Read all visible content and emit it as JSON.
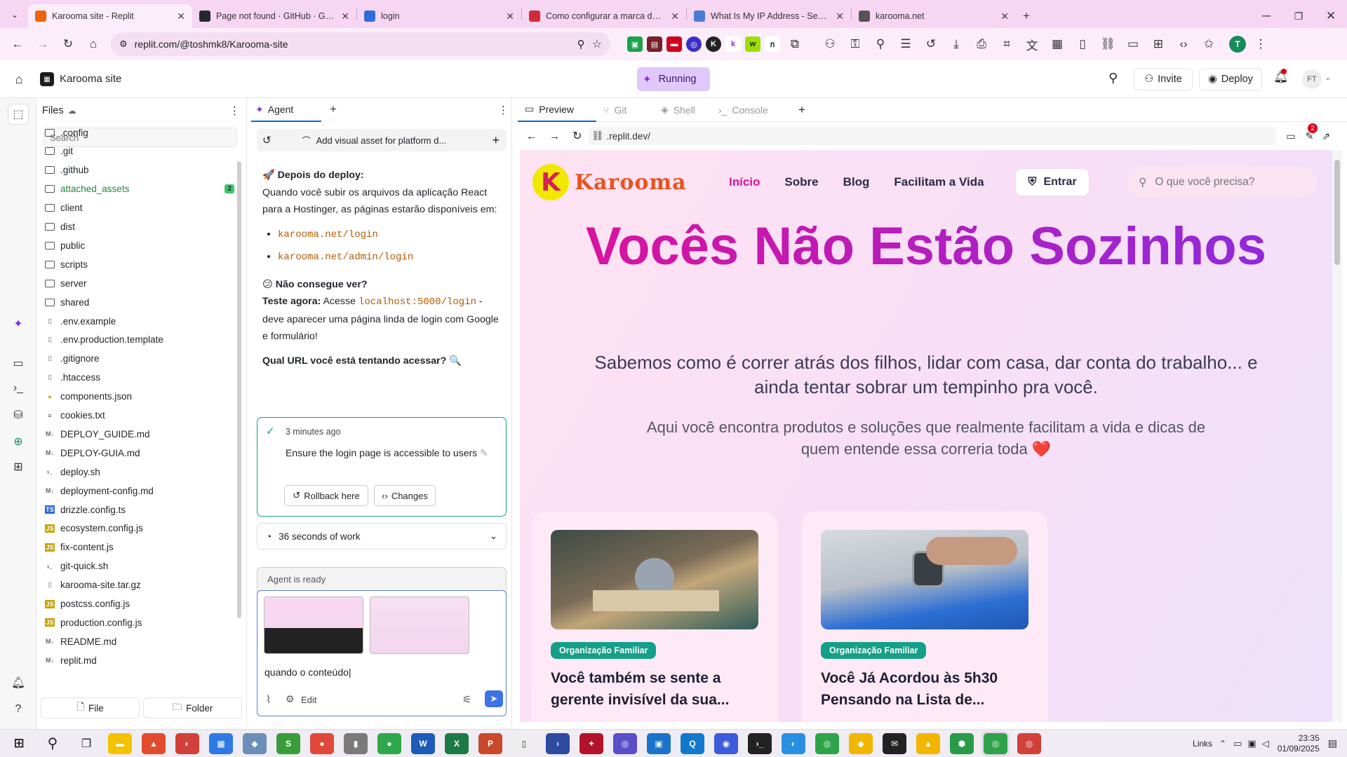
{
  "browser": {
    "tabs": [
      {
        "title": "Karooma site - Replit",
        "active": true,
        "color": "#f26207"
      },
      {
        "title": "Page not found · GitHub · GitHub",
        "active": false,
        "color": "#24292f"
      },
      {
        "title": "login",
        "active": false,
        "color": "#2f6cd8"
      },
      {
        "title": "Como configurar a marca de link",
        "active": false,
        "color": "#d12b3a"
      },
      {
        "title": "What Is My IP Address - See Your",
        "active": false,
        "color": "#4a7bd6"
      },
      {
        "title": "karooma.net",
        "active": false,
        "color": "#555555"
      }
    ],
    "url": "replit.com/@toshmk8/Karooma-site",
    "profile_initial": "T"
  },
  "replit": {
    "project_name": "Karooma site",
    "run_status": "Running",
    "invite_label": "Invite",
    "deploy_label": "Deploy",
    "user_initials": "FT"
  },
  "files": {
    "title": "Files",
    "search_placeholder": "Search",
    "attached_assets_count": "2",
    "items": [
      {
        "name": ".config",
        "type": "folder"
      },
      {
        "name": ".git",
        "type": "folder"
      },
      {
        "name": ".github",
        "type": "folder"
      },
      {
        "name": "attached_assets",
        "type": "folder"
      },
      {
        "name": "client",
        "type": "folder"
      },
      {
        "name": "dist",
        "type": "folder"
      },
      {
        "name": "public",
        "type": "folder"
      },
      {
        "name": "scripts",
        "type": "folder"
      },
      {
        "name": "server",
        "type": "folder"
      },
      {
        "name": "shared",
        "type": "folder"
      },
      {
        "name": ".env.example",
        "type": "file"
      },
      {
        "name": ".env.production.template",
        "type": "file"
      },
      {
        "name": ".gitignore",
        "type": "file"
      },
      {
        "name": ".htaccess",
        "type": "file"
      },
      {
        "name": "components.json",
        "type": "json"
      },
      {
        "name": "cookies.txt",
        "type": "txt"
      },
      {
        "name": "DEPLOY_GUIDE.md",
        "type": "md"
      },
      {
        "name": "DEPLOY-GUIA.md",
        "type": "md"
      },
      {
        "name": "deploy.sh",
        "type": "sh"
      },
      {
        "name": "deployment-config.md",
        "type": "md"
      },
      {
        "name": "drizzle.config.ts",
        "type": "ts"
      },
      {
        "name": "ecosystem.config.js",
        "type": "js"
      },
      {
        "name": "fix-content.js",
        "type": "js"
      },
      {
        "name": "git-quick.sh",
        "type": "sh"
      },
      {
        "name": "karooma-site.tar.gz",
        "type": "file"
      },
      {
        "name": "postcss.config.js",
        "type": "js"
      },
      {
        "name": "production.config.js",
        "type": "js"
      },
      {
        "name": "README.md",
        "type": "md"
      },
      {
        "name": "replit.md",
        "type": "md"
      }
    ],
    "new_file_label": "File",
    "new_folder_label": "Folder"
  },
  "agent": {
    "tab_label": "Agent",
    "thread_title": "Add visual asset for platform d...",
    "after_deploy_title": "🚀 Depois do deploy:",
    "after_deploy_text": "Quando você subir os arquivos da aplicação React para a Hostinger, as páginas estarão disponíveis em:",
    "urls": [
      "karooma.net/login",
      "karooma.net/admin/login"
    ],
    "cant_see_title": "😕 Não consegue ver?",
    "test_now_bold": "Teste agora:",
    "test_now_pre": " Acesse ",
    "test_now_code": "localhost:5000/login",
    "test_now_post": " - deve aparecer uma página linda de login com Google e formulário!",
    "question": "Qual URL você está tentando acessar? 🔍",
    "checkpoint_time": "3 minutes ago",
    "checkpoint_text": "Ensure the login page is accessible to users",
    "rollback_label": "Rollback here",
    "changes_label": "Changes",
    "work_summary": "36 seconds of work",
    "ready_label": "Agent is ready",
    "input_value": "quando o conteúdo",
    "edit_label": "Edit"
  },
  "preview": {
    "tabs": [
      "Preview",
      "Git",
      "Shell",
      "Console"
    ],
    "url": ".replit.dev/",
    "notif_count": "2"
  },
  "site": {
    "logo_text": "Karooma",
    "nav": [
      "Início",
      "Sobre",
      "Blog",
      "Facilitam a Vida"
    ],
    "login_label": "Entrar",
    "search_placeholder": "O que você precisa?",
    "headline": "Vocês Não Estão Sozinhos",
    "sub1": "Sabemos como é correr atrás dos filhos, lidar com casa, dar conta do trabalho... e ainda tentar sobrar um tempinho pra você.",
    "sub2": "Aqui você encontra produtos e soluções que realmente facilitam a vida e dicas de quem entende essa correria toda ❤️",
    "cards": [
      {
        "badge": "Organização Familiar",
        "title": "Você também se sente a gerente invisível da sua..."
      },
      {
        "badge": "Organização Familiar",
        "title": "Você Já Acordou às 5h30 Pensando na Lista de..."
      }
    ]
  },
  "taskbar": {
    "links_label": "Links",
    "time": "23:35",
    "date": "01/09/2025"
  },
  "colors": {
    "replit_orange": "#f26207",
    "running_purple": "#e0c8fb",
    "headline_start": "#e0109a",
    "headline_end": "#8a2be2",
    "nav_active": "#e0109a",
    "badge_teal": "#14a088"
  }
}
